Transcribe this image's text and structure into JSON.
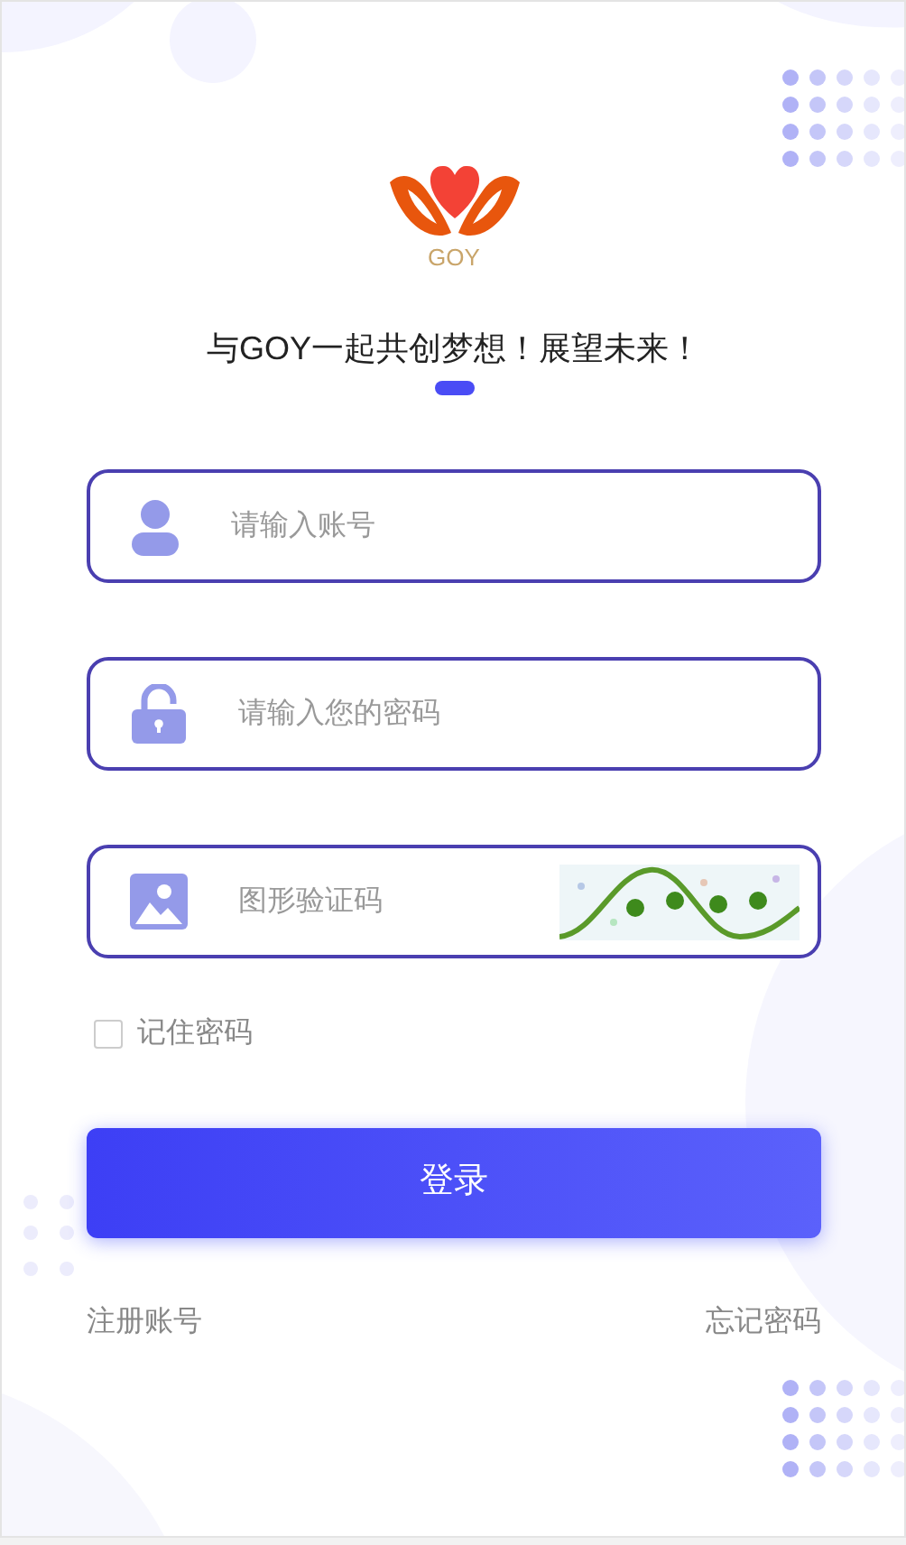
{
  "logo": {
    "text": "GOY"
  },
  "slogan": "与GOY一起共创梦想！展望未来！",
  "slides": [
    {
      "selected": true
    }
  ],
  "fields": [
    {
      "kind": "account",
      "placeholder": "请输入账号"
    },
    {
      "kind": "password",
      "placeholder": "请输入您的密码"
    },
    {
      "kind": "captcha",
      "placeholder": "图形验证码"
    }
  ],
  "remember": {
    "label": "记住密码",
    "checked": false
  },
  "login_button": "登录",
  "links": [
    "注册账号",
    "忘记密码"
  ]
}
